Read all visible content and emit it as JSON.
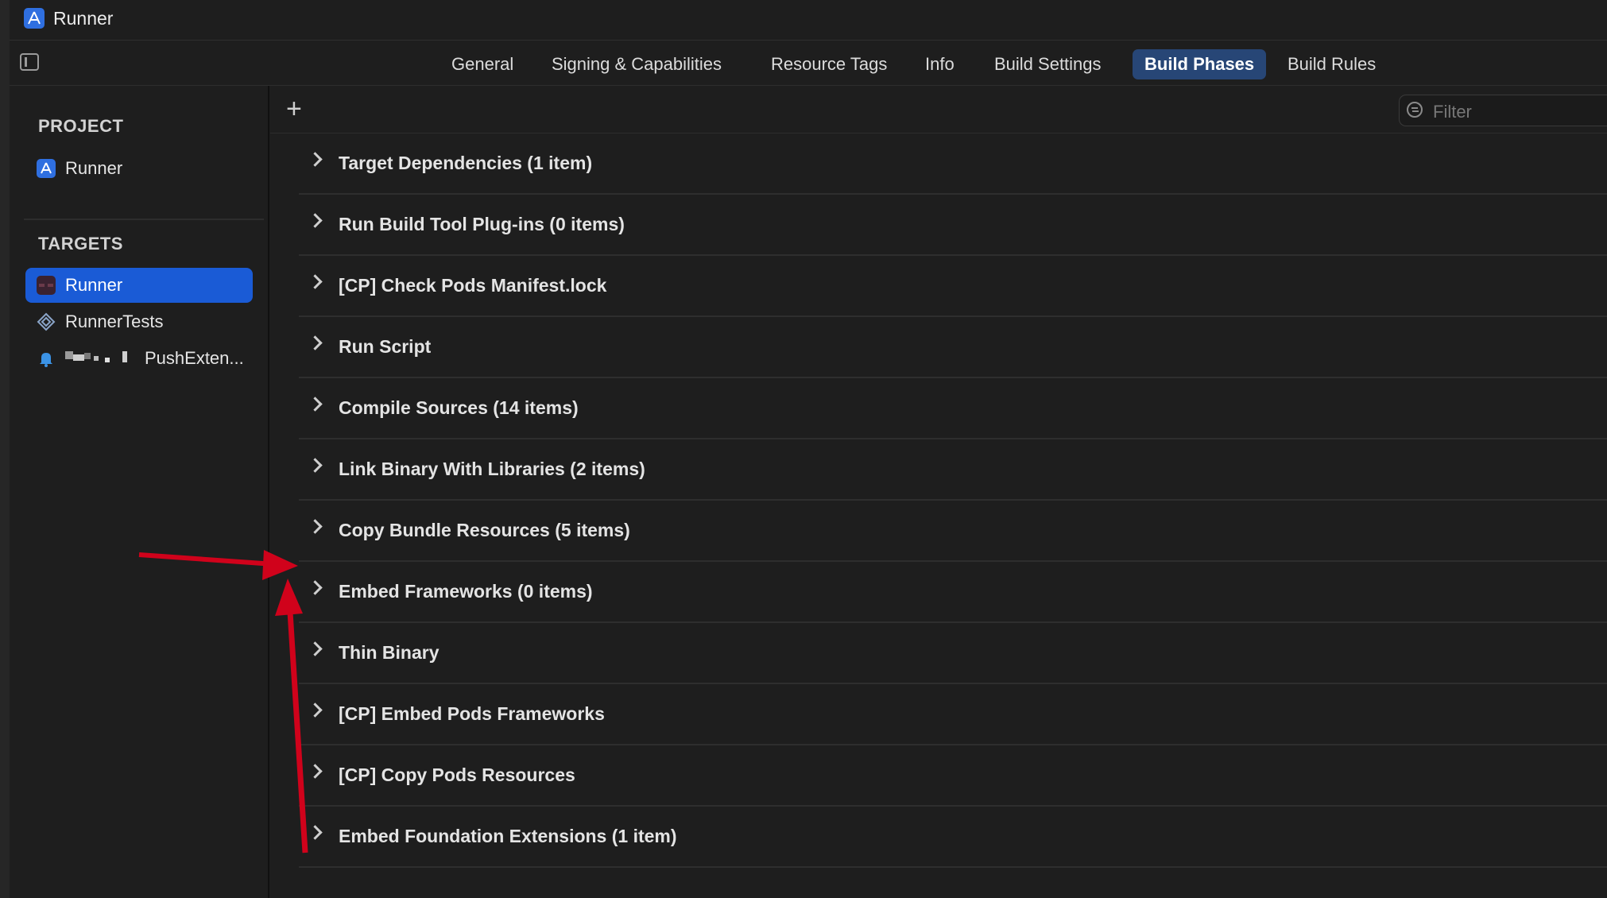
{
  "window": {
    "title": "Runner"
  },
  "tabs": [
    {
      "label": "General"
    },
    {
      "label": "Signing & Capabilities"
    },
    {
      "label": "Resource Tags"
    },
    {
      "label": "Info"
    },
    {
      "label": "Build Settings"
    },
    {
      "label": "Build Phases",
      "active": true
    },
    {
      "label": "Build Rules"
    }
  ],
  "sidebar": {
    "project_header": "PROJECT",
    "project_items": [
      {
        "label": "Runner",
        "icon": "app-project-icon"
      }
    ],
    "targets_header": "TARGETS",
    "target_items": [
      {
        "label": "Runner",
        "icon": "app-target-icon",
        "selected": true
      },
      {
        "label": "RunnerTests",
        "icon": "test-bundle-icon"
      },
      {
        "label": "PushExten...",
        "icon": "notification-bell-icon"
      }
    ]
  },
  "toolbar": {
    "add_label": "+",
    "filter_placeholder": "Filter"
  },
  "build_phases": [
    {
      "label": "Target Dependencies (1 item)"
    },
    {
      "label": "Run Build Tool Plug-ins (0 items)"
    },
    {
      "label": "[CP] Check Pods Manifest.lock"
    },
    {
      "label": "Run Script"
    },
    {
      "label": "Compile Sources (14 items)"
    },
    {
      "label": "Link Binary With Libraries (2 items)"
    },
    {
      "label": "Copy Bundle Resources (5 items)"
    },
    {
      "label": "Embed Frameworks (0 items)"
    },
    {
      "label": "Thin Binary"
    },
    {
      "label": "[CP] Embed Pods Frameworks"
    },
    {
      "label": "[CP] Copy Pods Resources"
    },
    {
      "label": "Embed Foundation Extensions (1 item)"
    }
  ],
  "colors": {
    "accent": "#1a5bd6",
    "active_tab": "#274676",
    "annotation_arrow": "#d0021b",
    "background": "#1e1e1e"
  }
}
